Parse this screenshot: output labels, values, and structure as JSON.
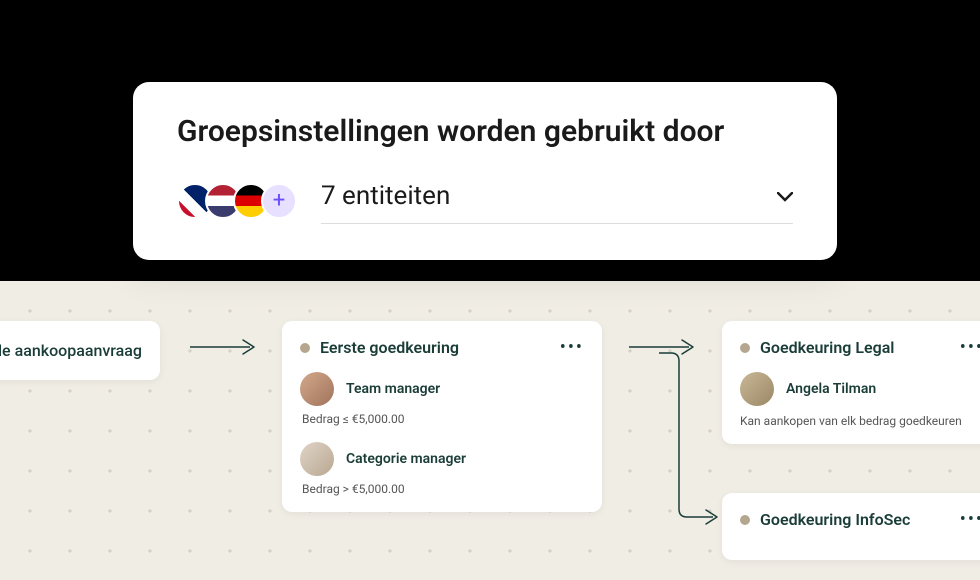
{
  "settings": {
    "title": "Groepsinstellingen worden gebruikt door",
    "entities_label": "7 entiteiten",
    "plus_label": "+"
  },
  "workflow": {
    "partial_card": {
      "text": "de aankoopaanvraag"
    },
    "approval1": {
      "title": "Eerste goedkeuring",
      "person1": "Team manager",
      "condition1": "Bedrag ≤ €5,000.00",
      "person2": "Categorie manager",
      "condition2": "Bedrag > €5,000.00"
    },
    "approval2": {
      "title": "Goedkeuring Legal",
      "person1": "Angela Tilman",
      "subtitle": "Kan aankopen van elk bedrag goedkeuren"
    },
    "approval3": {
      "title": "Goedkeuring InfoSec"
    }
  }
}
